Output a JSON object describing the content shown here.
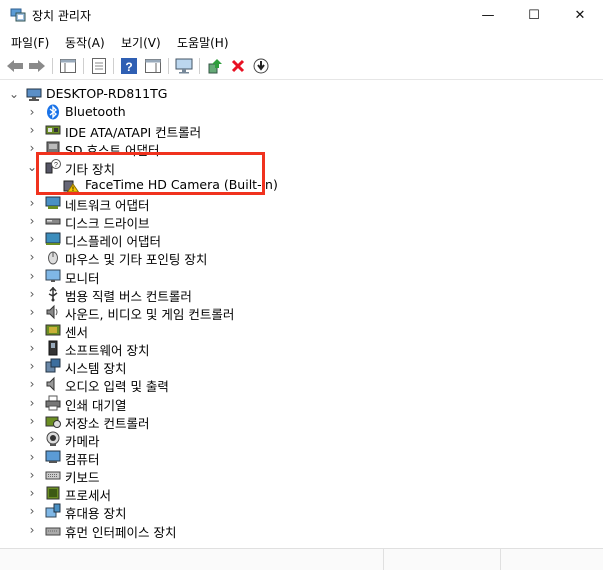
{
  "window": {
    "title": "장치 관리자",
    "minimize_glyph": "—",
    "maximize_glyph": "☐",
    "close_glyph": "✕"
  },
  "menu": [
    "파일(F)",
    "동작(A)",
    "보기(V)",
    "도움말(H)"
  ],
  "tree": {
    "root": "DESKTOP-RD811TG",
    "nodes": [
      {
        "label": "Bluetooth",
        "icon": "bluetooth-icon"
      },
      {
        "label": "IDE ATA/ATAPI 컨트롤러",
        "icon": "ide-controller-icon"
      },
      {
        "label": "SD 호스트 어댑터",
        "icon": "sd-host-icon"
      },
      {
        "label": "기타 장치",
        "icon": "unknown-device-icon",
        "expanded": true,
        "children": [
          {
            "label": "FaceTime HD Camera (Built-in)",
            "icon": "warning-device-icon"
          }
        ]
      },
      {
        "label": "네트워크 어댑터",
        "icon": "network-adapter-icon"
      },
      {
        "label": "디스크 드라이브",
        "icon": "disk-drive-icon"
      },
      {
        "label": "디스플레이 어댑터",
        "icon": "display-adapter-icon"
      },
      {
        "label": "마우스 및 기타 포인팅 장치",
        "icon": "mouse-icon"
      },
      {
        "label": "모니터",
        "icon": "monitor-icon"
      },
      {
        "label": "범용 직렬 버스 컨트롤러",
        "icon": "usb-icon"
      },
      {
        "label": "사운드, 비디오 및 게임 컨트롤러",
        "icon": "speaker-icon"
      },
      {
        "label": "센서",
        "icon": "sensor-icon"
      },
      {
        "label": "소프트웨어 장치",
        "icon": "software-device-icon"
      },
      {
        "label": "시스템 장치",
        "icon": "system-device-icon"
      },
      {
        "label": "오디오 입력 및 출력",
        "icon": "audio-io-icon"
      },
      {
        "label": "인쇄 대기열",
        "icon": "printer-icon"
      },
      {
        "label": "저장소 컨트롤러",
        "icon": "storage-controller-icon"
      },
      {
        "label": "카메라",
        "icon": "camera-icon"
      },
      {
        "label": "컴퓨터",
        "icon": "computer-icon"
      },
      {
        "label": "키보드",
        "icon": "keyboard-icon"
      },
      {
        "label": "프로세서",
        "icon": "processor-icon"
      },
      {
        "label": "휴대용 장치",
        "icon": "portable-device-icon"
      },
      {
        "label": "휴먼 인터페이스 장치",
        "icon": "hid-icon"
      }
    ]
  },
  "colors": {
    "highlight": "#f0321e",
    "remove_red": "#e81123",
    "bluetooth_blue": "#1a73e8",
    "warning_yellow": "#f5c400"
  }
}
